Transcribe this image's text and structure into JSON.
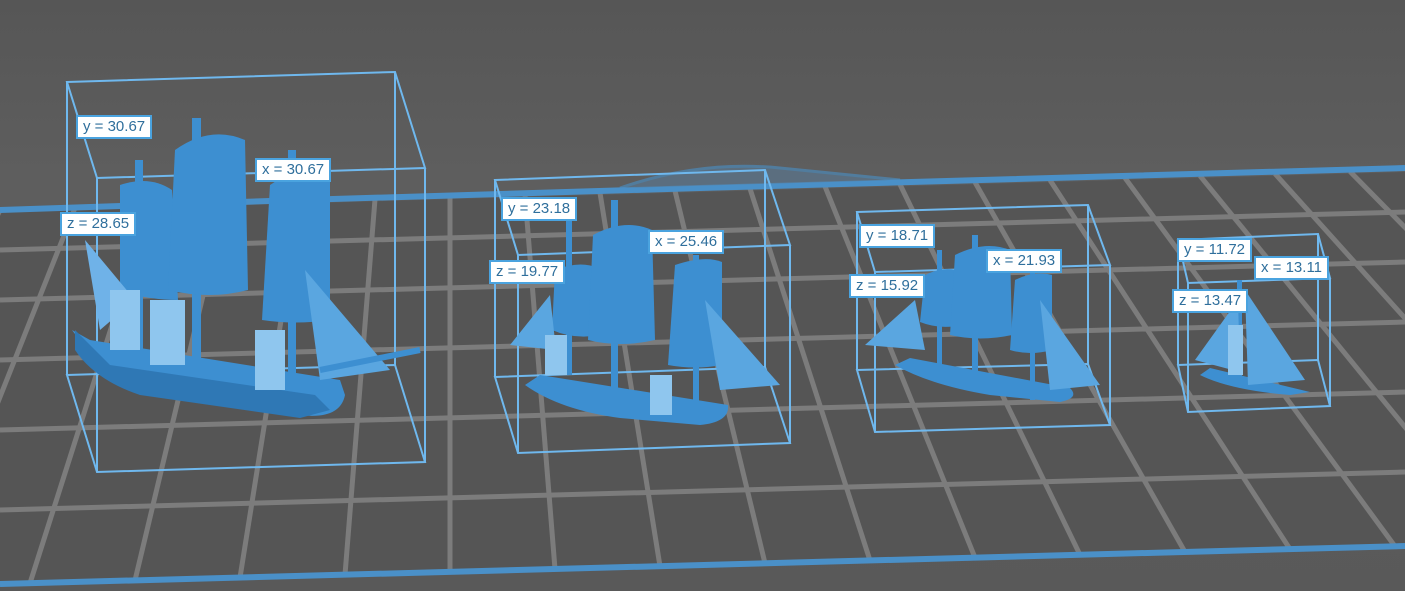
{
  "colors": {
    "background": "#5a5a5a",
    "bed_grid": "#7a7a7a",
    "bed_edge": "#4a90c8",
    "model": "#3d8fd1",
    "bbox": "#6fb8ee",
    "label_border": "#4aa3df",
    "label_text": "#2f6f9c"
  },
  "models": [
    {
      "name": "ship-large",
      "y_label": "y = 30.67",
      "x_label": "x = 30.67",
      "z_label": "z = 28.65"
    },
    {
      "name": "ship-medium",
      "y_label": "y = 23.18",
      "x_label": "x = 25.46",
      "z_label": "z = 19.77"
    },
    {
      "name": "ship-small",
      "y_label": "y = 18.71",
      "x_label": "x = 21.93",
      "z_label": "z = 15.92"
    },
    {
      "name": "ship-tiny",
      "y_label": "y = 11.72",
      "x_label": "x = 13.11",
      "z_label": "z = 13.47"
    }
  ]
}
